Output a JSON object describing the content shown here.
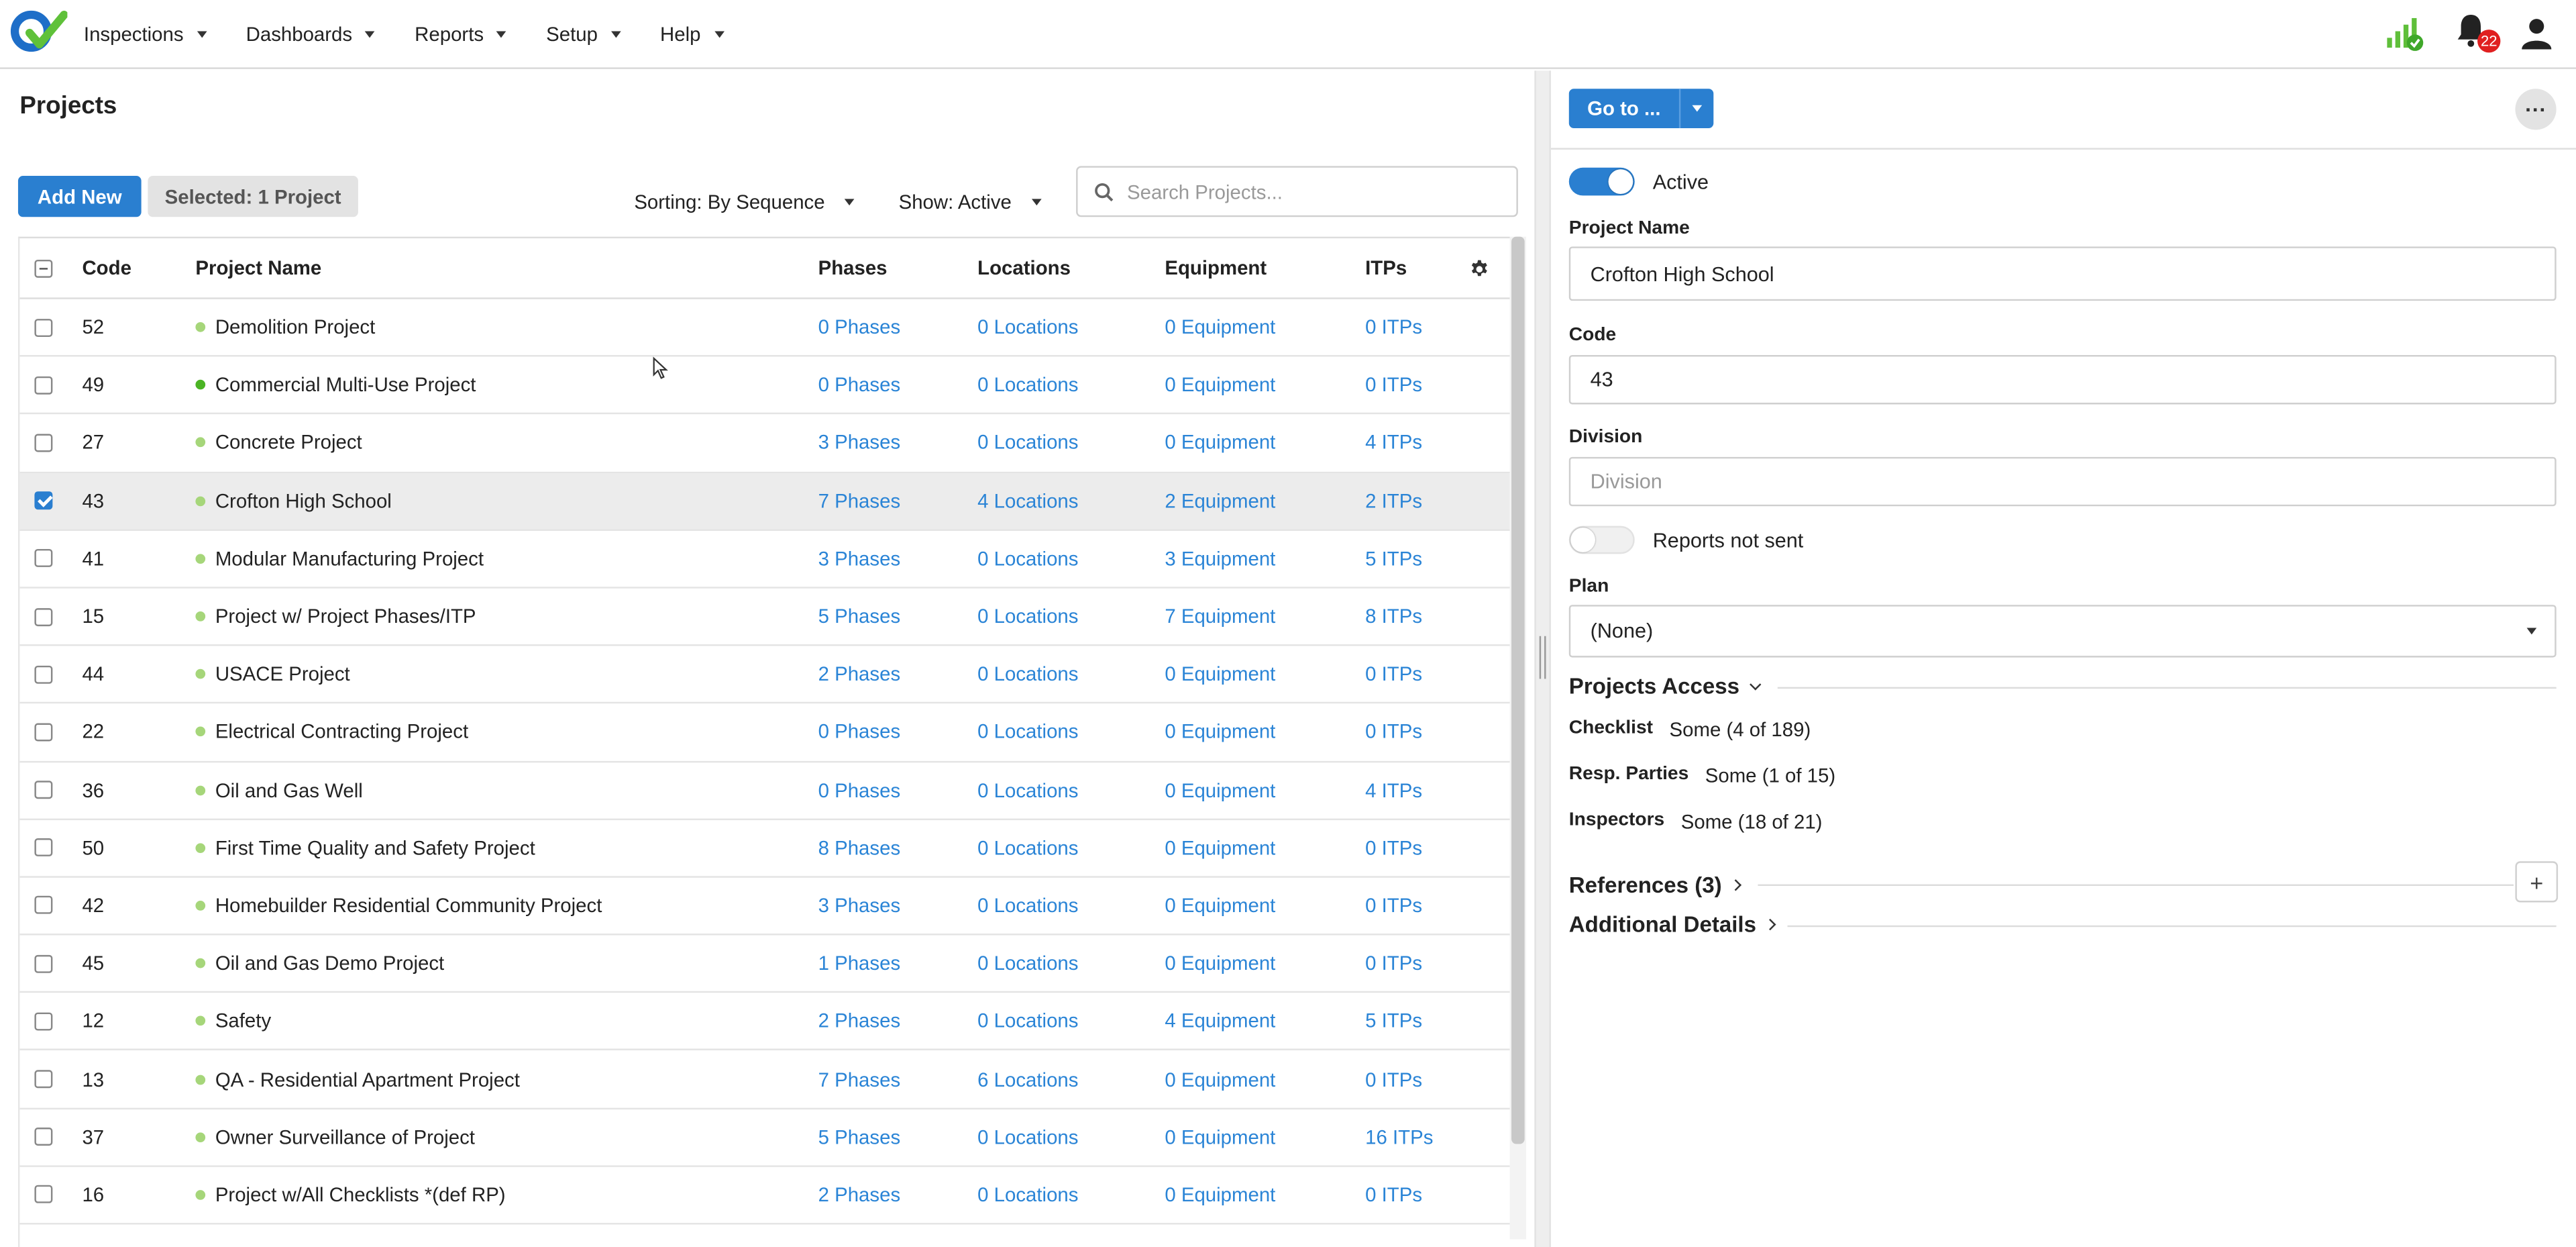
{
  "nav": {
    "items": [
      {
        "label": "Inspections"
      },
      {
        "label": "Dashboards"
      },
      {
        "label": "Reports"
      },
      {
        "label": "Setup"
      },
      {
        "label": "Help"
      }
    ],
    "notification_count": "22"
  },
  "left": {
    "title": "Projects",
    "add_new_label": "Add New",
    "selected_label": "Selected: 1 Project",
    "sorting_label": "Sorting: By Sequence",
    "show_label": "Show: Active",
    "search_placeholder": "Search Projects..."
  },
  "table": {
    "headers": {
      "code": "Code",
      "name": "Project Name",
      "phases": "Phases",
      "locations": "Locations",
      "equipment": "Equipment",
      "itps": "ITPs"
    },
    "rows": [
      {
        "code": "52",
        "name": "Demolition Project",
        "phases": "0 Phases",
        "locations": "0 Locations",
        "equipment": "0 Equipment",
        "itps": "0 ITPs"
      },
      {
        "code": "49",
        "name": "Commercial Multi-Use Project",
        "phases": "0 Phases",
        "locations": "0 Locations",
        "equipment": "0 Equipment",
        "itps": "0 ITPs"
      },
      {
        "code": "27",
        "name": "Concrete Project",
        "phases": "3 Phases",
        "locations": "0 Locations",
        "equipment": "0 Equipment",
        "itps": "4 ITPs"
      },
      {
        "code": "43",
        "name": "Crofton High School",
        "phases": "7 Phases",
        "locations": "4 Locations",
        "equipment": "2 Equipment",
        "itps": "2 ITPs"
      },
      {
        "code": "41",
        "name": "Modular Manufacturing Project",
        "phases": "3 Phases",
        "locations": "0 Locations",
        "equipment": "3 Equipment",
        "itps": "5 ITPs"
      },
      {
        "code": "15",
        "name": "Project w/ Project Phases/ITP",
        "phases": "5 Phases",
        "locations": "0 Locations",
        "equipment": "7 Equipment",
        "itps": "8 ITPs"
      },
      {
        "code": "44",
        "name": "USACE Project",
        "phases": "2 Phases",
        "locations": "0 Locations",
        "equipment": "0 Equipment",
        "itps": "0 ITPs"
      },
      {
        "code": "22",
        "name": "Electrical Contracting Project",
        "phases": "0 Phases",
        "locations": "0 Locations",
        "equipment": "0 Equipment",
        "itps": "0 ITPs"
      },
      {
        "code": "36",
        "name": "Oil and Gas Well",
        "phases": "0 Phases",
        "locations": "0 Locations",
        "equipment": "0 Equipment",
        "itps": "4 ITPs"
      },
      {
        "code": "50",
        "name": "First Time Quality and Safety Project",
        "phases": "8 Phases",
        "locations": "0 Locations",
        "equipment": "0 Equipment",
        "itps": "0 ITPs"
      },
      {
        "code": "42",
        "name": "Homebuilder Residential Community Project",
        "phases": "3 Phases",
        "locations": "0 Locations",
        "equipment": "0 Equipment",
        "itps": "0 ITPs"
      },
      {
        "code": "45",
        "name": "Oil and Gas Demo Project",
        "phases": "1 Phases",
        "locations": "0 Locations",
        "equipment": "0 Equipment",
        "itps": "0 ITPs"
      },
      {
        "code": "12",
        "name": "Safety",
        "phases": "2 Phases",
        "locations": "0 Locations",
        "equipment": "4 Equipment",
        "itps": "5 ITPs"
      },
      {
        "code": "13",
        "name": "QA - Residential Apartment Project",
        "phases": "7 Phases",
        "locations": "6 Locations",
        "equipment": "0 Equipment",
        "itps": "0 ITPs"
      },
      {
        "code": "37",
        "name": "Owner Surveillance of Project",
        "phases": "5 Phases",
        "locations": "0 Locations",
        "equipment": "0 Equipment",
        "itps": "16 ITPs"
      },
      {
        "code": "16",
        "name": "Project w/All Checklists *(def RP)",
        "phases": "2 Phases",
        "locations": "0 Locations",
        "equipment": "0 Equipment",
        "itps": "0 ITPs"
      }
    ]
  },
  "detail": {
    "goto_label": "Go to ...",
    "active_label": "Active",
    "project_name_label": "Project Name",
    "project_name_value": "Crofton High School",
    "code_label": "Code",
    "code_value": "43",
    "division_label": "Division",
    "division_placeholder": "Division",
    "reports_not_sent_label": "Reports not sent",
    "plan_label": "Plan",
    "plan_value": "(None)",
    "projects_access_label": "Projects Access",
    "access": [
      {
        "label": "Checklist",
        "value": "Some (4 of 189)"
      },
      {
        "label": "Resp. Parties",
        "value": "Some (1 of 15)"
      },
      {
        "label": "Inspectors",
        "value": "Some (18 of 21)"
      }
    ],
    "references_label": "References (3)",
    "additional_details_label": "Additional Details"
  },
  "colors": {
    "primary": "#2a7fd0",
    "link": "#2a84d6",
    "status_dot": "#a6d67a",
    "badge": "#e02020"
  }
}
